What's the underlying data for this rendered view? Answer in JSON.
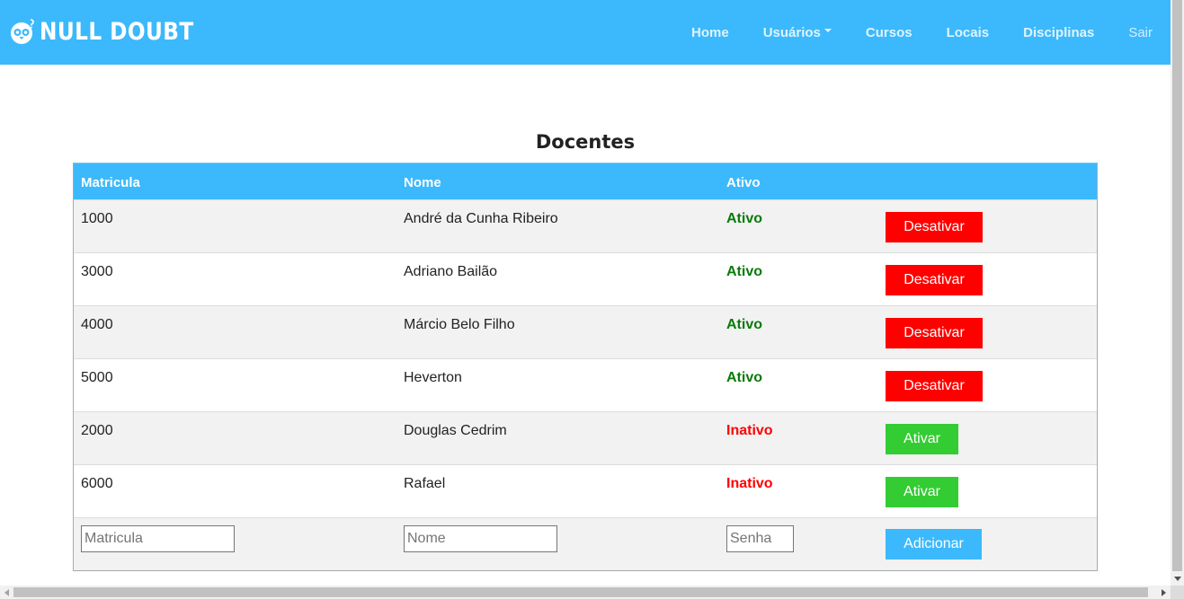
{
  "brand": {
    "name": "NULL DOUBT"
  },
  "nav": {
    "items": [
      {
        "label": "Home"
      },
      {
        "label": "Usuários"
      },
      {
        "label": "Cursos"
      },
      {
        "label": "Locais"
      },
      {
        "label": "Disciplinas"
      },
      {
        "label": "Sair"
      }
    ]
  },
  "page": {
    "title": "Docentes"
  },
  "table": {
    "headers": [
      "Matricula",
      "Nome",
      "Ativo",
      ""
    ],
    "rows": [
      {
        "matricula": "1000",
        "nome": "André da Cunha Ribeiro",
        "status": "Ativo",
        "action": "Desativar"
      },
      {
        "matricula": "3000",
        "nome": "Adriano Bailão",
        "status": "Ativo",
        "action": "Desativar"
      },
      {
        "matricula": "4000",
        "nome": "Márcio Belo Filho",
        "status": "Ativo",
        "action": "Desativar"
      },
      {
        "matricula": "5000",
        "nome": "Heverton",
        "status": "Ativo",
        "action": "Desativar"
      },
      {
        "matricula": "2000",
        "nome": "Douglas Cedrim",
        "status": "Inativo",
        "action": "Ativar"
      },
      {
        "matricula": "6000",
        "nome": "Rafael",
        "status": "Inativo",
        "action": "Ativar"
      }
    ],
    "new_row": {
      "matricula_placeholder": "Matricula",
      "nome_placeholder": "Nome",
      "senha_placeholder": "Senha",
      "add_label": "Adicionar"
    }
  },
  "colors": {
    "primary": "#3cb9fc",
    "active_text": "#0a7a0a",
    "inactive_text": "#ff0000",
    "deactivate_button": "#ff0000",
    "activate_button": "#33cc33"
  }
}
